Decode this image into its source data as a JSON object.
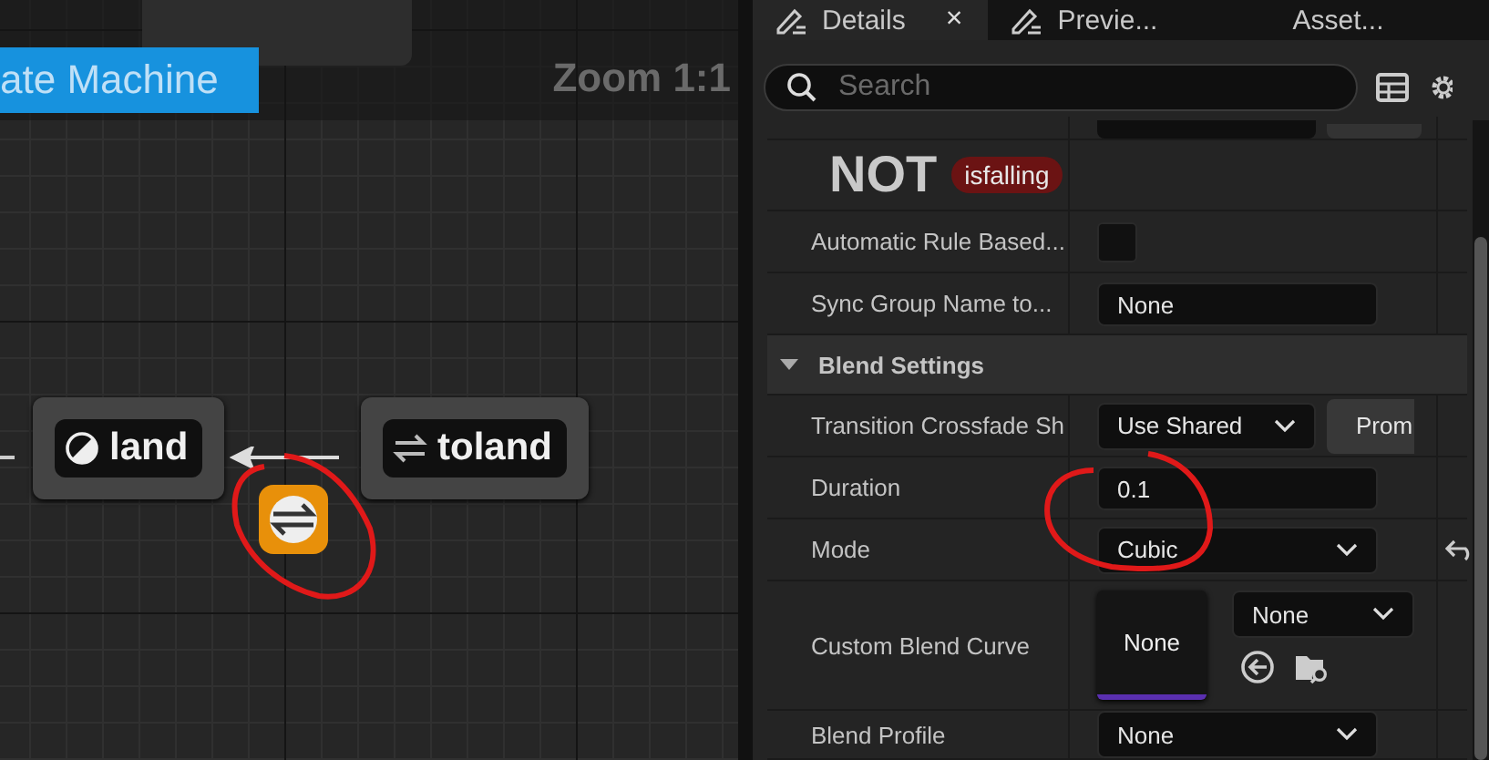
{
  "graph": {
    "title": "ate Machine",
    "zoom": "Zoom 1:1",
    "nodes": [
      {
        "label": "land",
        "kind": "state"
      },
      {
        "label": "toland",
        "kind": "conduit"
      }
    ]
  },
  "details": {
    "tabs": [
      {
        "label": "Details",
        "selected": true,
        "close": "×"
      },
      {
        "label": "Previe...",
        "selected": false
      },
      {
        "label": "Asset...",
        "selected": false
      }
    ],
    "search": {
      "placeholder": "Search"
    },
    "condition": {
      "operator": "NOT",
      "variable": "isfalling"
    },
    "rows": [
      {
        "kind": "checkbox",
        "label": "Automatic Rule Based...",
        "checked": false
      },
      {
        "kind": "text",
        "label": "Sync Group Name to...",
        "value": "None"
      },
      {
        "kind": "header",
        "label": "Blend Settings",
        "expanded": true
      },
      {
        "kind": "dropdown-button",
        "label": "Transition Crossfade Sh",
        "value": "Use Shared",
        "button": "Prom"
      },
      {
        "kind": "number",
        "label": "Duration",
        "value": "0.1"
      },
      {
        "kind": "dropdown",
        "label": "Mode",
        "value": "Cubic",
        "resettable": true
      },
      {
        "kind": "asset",
        "label": "Custom Blend Curve",
        "thumbnail": "None",
        "value": "None"
      },
      {
        "kind": "dropdown",
        "label": "Blend Profile",
        "value": "None",
        "resettable": false
      }
    ]
  }
}
